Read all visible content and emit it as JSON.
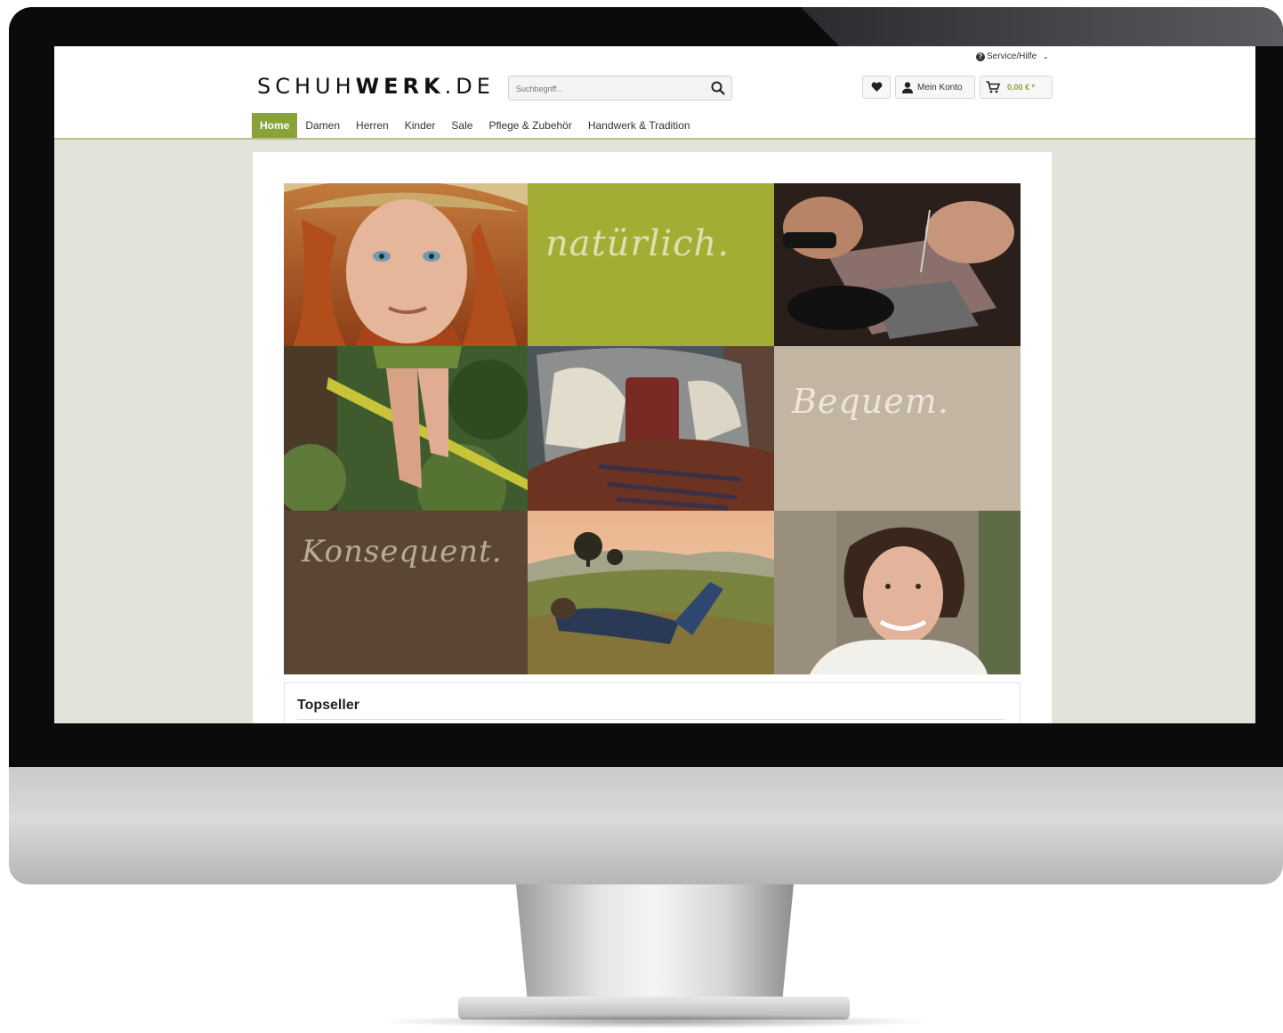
{
  "header": {
    "logo_light": "SCHUH",
    "logo_bold": "WERK",
    "logo_suffix": ".DE",
    "service_link": "Service/Hilfe",
    "search_placeholder": "Suchbegriff...",
    "account_label": "Mein Konto",
    "cart_amount": "0,00 € *"
  },
  "nav": {
    "items": [
      {
        "label": "Home",
        "active": true
      },
      {
        "label": "Damen"
      },
      {
        "label": "Herren"
      },
      {
        "label": "Kinder"
      },
      {
        "label": "Sale"
      },
      {
        "label": "Pflege & Zubehör"
      },
      {
        "label": "Handwerk & Tradition"
      }
    ]
  },
  "hero": {
    "word_1": "natürlich.",
    "word_2": "Bequem.",
    "word_3": "Konsequent."
  },
  "topseller": {
    "title": "Topseller"
  },
  "colors": {
    "accent": "#8aa23a",
    "tile_green": "#a3ad34",
    "tile_beige": "#c3b5a2",
    "tile_brown": "#5b4634",
    "page_background": "#e2e2d8"
  }
}
